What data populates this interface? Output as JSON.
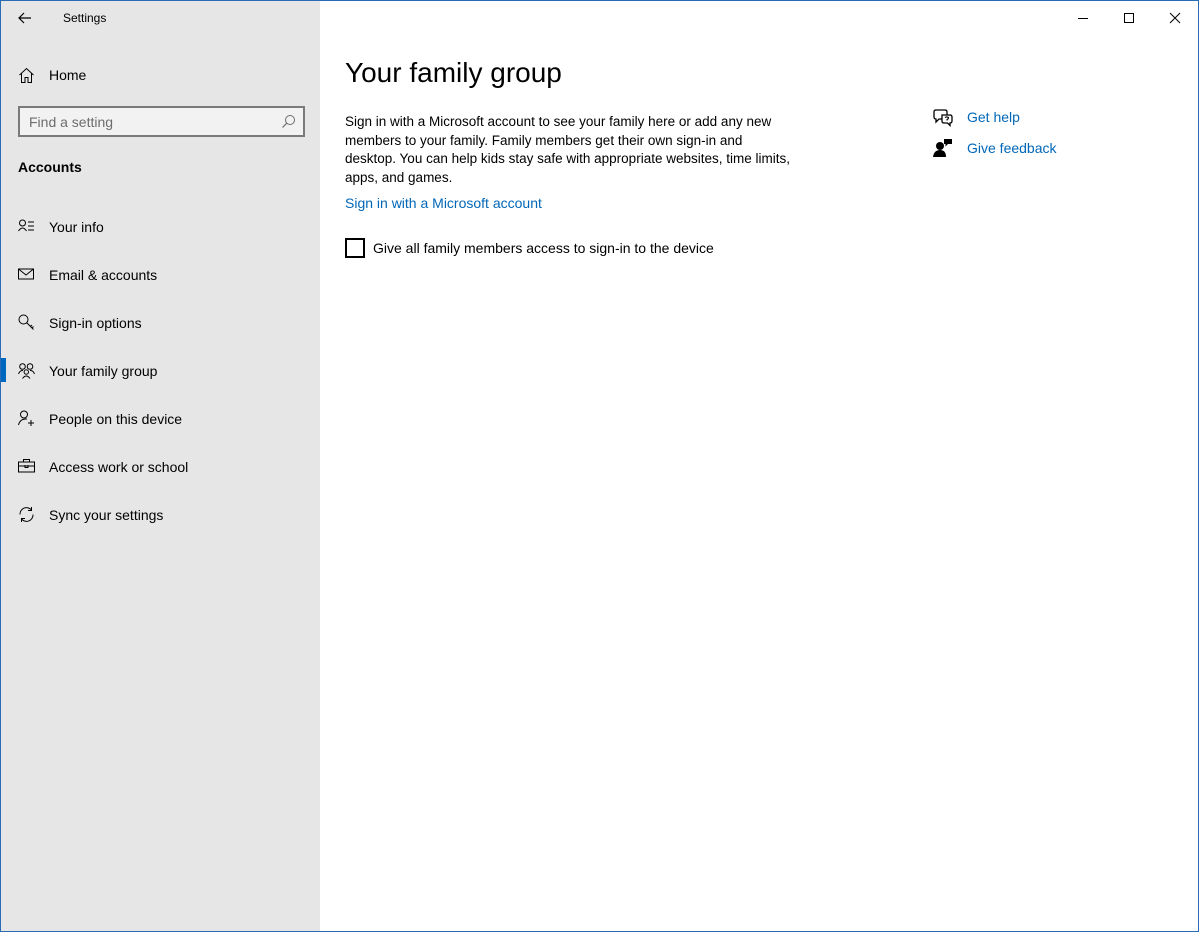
{
  "window": {
    "title": "Settings"
  },
  "sidebar": {
    "home_label": "Home",
    "search_placeholder": "Find a setting",
    "section_title": "Accounts",
    "items": [
      {
        "label": "Your info",
        "icon": "person-card-icon"
      },
      {
        "label": "Email & accounts",
        "icon": "envelope-icon"
      },
      {
        "label": "Sign-in options",
        "icon": "key-icon"
      },
      {
        "label": "Your family group",
        "icon": "family-icon",
        "active": true
      },
      {
        "label": "People on this device",
        "icon": "person-add-icon"
      },
      {
        "label": "Access work or school",
        "icon": "briefcase-icon"
      },
      {
        "label": "Sync your settings",
        "icon": "sync-icon"
      }
    ]
  },
  "main": {
    "title": "Your family group",
    "description": "Sign in with a Microsoft account to see your family here or add any new members to your family. Family members get their own sign-in and desktop. You can help kids stay safe with appropriate websites, time limits, apps, and games.",
    "signin_link": "Sign in with a Microsoft account",
    "checkbox_label": "Give all family members access to sign-in to the device",
    "checkbox_checked": false
  },
  "help": {
    "get_help": "Get help",
    "give_feedback": "Give feedback"
  },
  "colors": {
    "accent": "#0067c0",
    "link": "#0067b8",
    "sidebar_bg": "#e6e6e6",
    "window_border": "#2b6bb5"
  }
}
